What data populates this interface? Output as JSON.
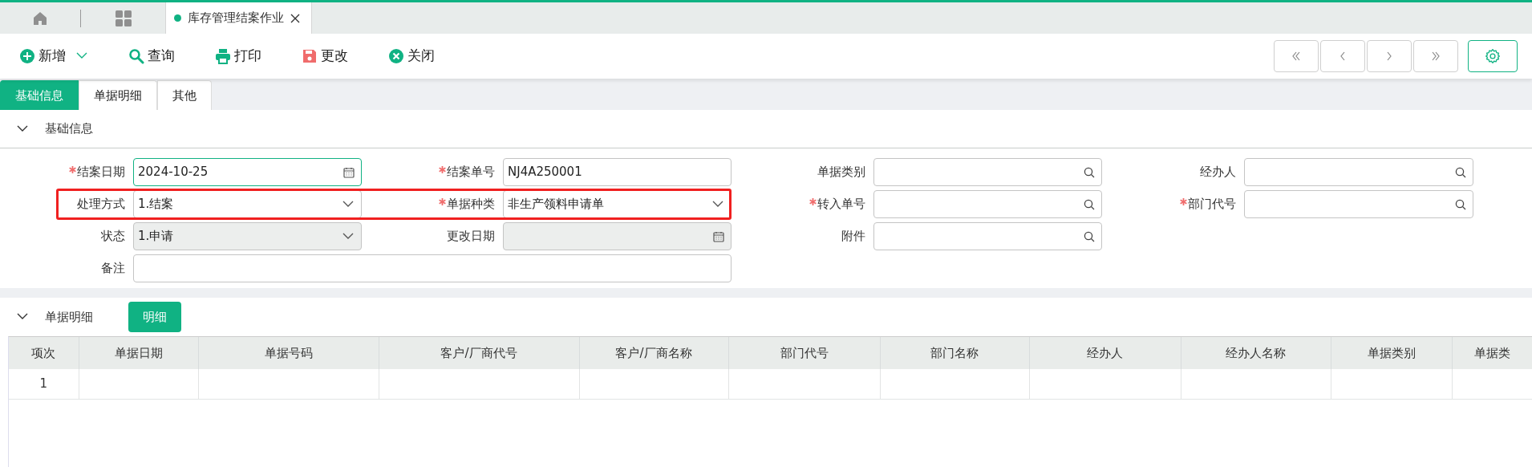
{
  "app_tabs": [
    {
      "kind": "home",
      "selected": false
    },
    {
      "kind": "grid",
      "selected": false
    },
    {
      "kind": "page",
      "label": "库存管理结案作业",
      "selected": true
    }
  ],
  "toolbar": [
    {
      "kind": "plus",
      "label": "新增",
      "dropdown": true
    },
    {
      "kind": "search",
      "label": "查询",
      "dropdown": false
    },
    {
      "kind": "print",
      "label": "打印",
      "dropdown": false
    },
    {
      "kind": "save",
      "label": "更改",
      "dropdown": false
    },
    {
      "kind": "close",
      "label": "关闭",
      "dropdown": false
    }
  ],
  "pager": [
    {
      "kind": "first"
    },
    {
      "kind": "prev"
    },
    {
      "kind": "next"
    },
    {
      "kind": "last"
    }
  ],
  "form_tabs": [
    {
      "label": "基础信息",
      "selected": true
    },
    {
      "label": "单据明细",
      "selected": false
    },
    {
      "label": "其他",
      "selected": false
    }
  ],
  "basic_section": {
    "title": "基础信息",
    "expanded": true,
    "rows": [
      [
        {
          "label": "结案日期",
          "required": true,
          "kind": "date",
          "value": "2024-10-25",
          "disabled": false,
          "focused": true,
          "highlighted": false
        },
        {
          "label": "结案单号",
          "required": true,
          "kind": "text",
          "value": "NJ4A250001",
          "disabled": false,
          "focused": false,
          "highlighted": false
        },
        {
          "label": "单据类别",
          "required": false,
          "kind": "search",
          "disabled": false,
          "focused": false,
          "highlighted": false
        },
        {
          "label": "经办人",
          "required": false,
          "kind": "search",
          "disabled": false,
          "focused": false,
          "highlighted": false
        }
      ],
      [
        {
          "label": "处理方式",
          "required": false,
          "kind": "select",
          "value": "1.结案",
          "disabled": false,
          "focused": false,
          "highlighted": true
        },
        {
          "label": "单据种类",
          "required": true,
          "kind": "select",
          "value": "非生产领料申请单",
          "disabled": false,
          "focused": false,
          "highlighted": true
        },
        {
          "label": "转入单号",
          "required": true,
          "kind": "search",
          "disabled": false,
          "focused": false,
          "highlighted": false
        },
        {
          "label": "部门代号",
          "required": true,
          "kind": "search",
          "disabled": false,
          "focused": false,
          "highlighted": false
        }
      ],
      [
        {
          "label": "状态",
          "required": false,
          "kind": "select",
          "value": "1.申请",
          "disabled": true,
          "focused": false,
          "highlighted": false
        },
        {
          "label": "更改日期",
          "required": false,
          "kind": "date",
          "disabled": true,
          "focused": false,
          "highlighted": false
        },
        {
          "label": "附件",
          "required": false,
          "kind": "search",
          "disabled": false,
          "focused": false,
          "highlighted": false
        }
      ],
      [
        {
          "label": "备注",
          "required": false,
          "kind": "memo",
          "disabled": false,
          "focused": false,
          "highlighted": false
        }
      ]
    ]
  },
  "detail_section": {
    "title": "单据明细",
    "expanded": true,
    "button": "明细",
    "table": {
      "columns": [
        "项次",
        "单据日期",
        "单据号码",
        "客户/厂商代号",
        "客户/厂商名称",
        "部门代号",
        "部门名称",
        "经办人",
        "经办人名称",
        "单据类别",
        "单据类"
      ],
      "rows": [
        [
          "1",
          "",
          "",
          "",
          "",
          "",
          "",
          "",
          "",
          "",
          ""
        ]
      ]
    }
  }
}
